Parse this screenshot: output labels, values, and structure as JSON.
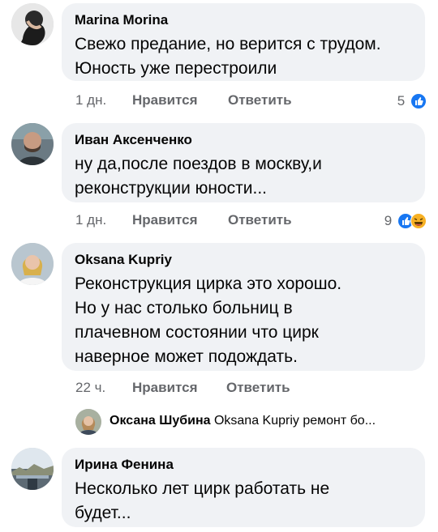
{
  "comments": [
    {
      "author": "Marina Morina",
      "text_lines": [
        "Свежо предание, но верится с трудом.",
        "Юность уже перестроили"
      ],
      "time": "1 дн.",
      "like_label": "Нравится",
      "reply_label": "Ответить",
      "reaction_count": "5",
      "reactions": [
        "like-reaction-icon"
      ]
    },
    {
      "author": "Иван Аксенченко",
      "text_lines": [
        "ну да,после поездов в москву,и",
        "реконструкции юности..."
      ],
      "time": "1 дн.",
      "like_label": "Нравится",
      "reply_label": "Ответить",
      "reaction_count": "9",
      "reactions": [
        "like-reaction-icon",
        "haha-reaction-icon"
      ]
    },
    {
      "author": "Oksana Kupriy",
      "text_lines": [
        "Реконструкция цирка это хорошо.",
        "Но у нас столько больниц в",
        "плачевном состоянии что цирк",
        "наверное может подождать."
      ],
      "time": "22 ч.",
      "like_label": "Нравится",
      "reply_label": "Ответить",
      "reply_preview": {
        "name": "Оксана Шубина",
        "snippet": "Oksana Kupriy ремонт бо..."
      }
    },
    {
      "author": "Ирина Фенина",
      "text_lines": [
        "Несколько лет цирк работать не",
        "будет..."
      ]
    }
  ],
  "colors": {
    "bubble": "#f0f2f5",
    "meta": "#65676b",
    "like_blue": "#1877f2",
    "haha_yellow": "#f7b125"
  }
}
